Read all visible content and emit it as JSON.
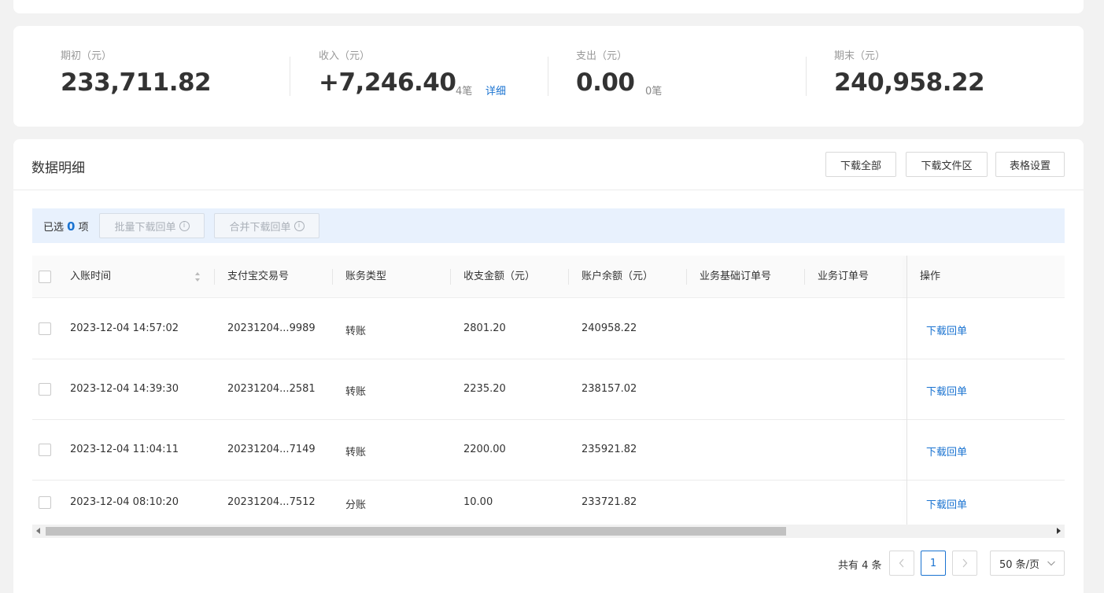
{
  "summary": {
    "opening": {
      "label": "期初（元）",
      "value": "233,711.82"
    },
    "income": {
      "label": "收入（元）",
      "value": "+7,246.40",
      "count": "4笔",
      "detail_link": "详细"
    },
    "expense": {
      "label": "支出（元）",
      "value": "0.00",
      "count": "0笔"
    },
    "closing": {
      "label": "期末（元）",
      "value": "240,958.22"
    }
  },
  "detail": {
    "title": "数据明细",
    "buttons": {
      "download_all": "下载全部",
      "download_folder": "下载文件区",
      "table_settings": "表格设置"
    }
  },
  "selection": {
    "prefix": "已选",
    "count": "0",
    "suffix": "项",
    "batch_download": "批量下载回单",
    "merge_download": "合并下载回单"
  },
  "table": {
    "columns": [
      "入账时间",
      "支付宝交易号",
      "账务类型",
      "收支金额（元）",
      "账户余额（元）",
      "业务基础订单号",
      "业务订单号",
      "操作"
    ],
    "rows": [
      {
        "time": "2023-12-04 14:57:02",
        "trade_no": "20231204...9989",
        "type": "转账",
        "amount": "2801.20",
        "balance": "240958.22",
        "base_order": "",
        "order": "",
        "action": "下载回单"
      },
      {
        "time": "2023-12-04 14:39:30",
        "trade_no": "20231204...2581",
        "type": "转账",
        "amount": "2235.20",
        "balance": "238157.02",
        "base_order": "",
        "order": "",
        "action": "下载回单"
      },
      {
        "time": "2023-12-04 11:04:11",
        "trade_no": "20231204...7149",
        "type": "转账",
        "amount": "2200.00",
        "balance": "235921.82",
        "base_order": "",
        "order": "",
        "action": "下载回单"
      },
      {
        "time": "2023-12-04 08:10:20",
        "trade_no": "20231204...7512",
        "type": "分账",
        "amount": "10.00",
        "balance": "233721.82",
        "base_order": "",
        "order": "",
        "action": "下载回单"
      }
    ]
  },
  "pagination": {
    "total_text": "共有 4 条",
    "current_page": "1",
    "page_size": "50 条/页"
  },
  "colors": {
    "accent": "#1a73d1",
    "selection_bg": "#e8f1fd",
    "page_bg": "#f2f2f2"
  },
  "icons": [
    "sort-icon",
    "info-icon",
    "chevron-left-icon",
    "chevron-right-icon",
    "chevron-down-icon",
    "scroll-left-arrow",
    "scroll-right-arrow"
  ]
}
